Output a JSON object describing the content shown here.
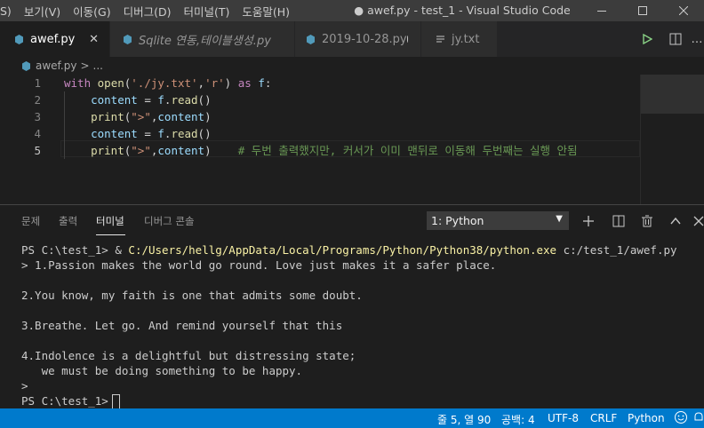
{
  "menu": [
    "S)",
    "보기(V)",
    "이동(G)",
    "디버그(D)",
    "터미널(T)",
    "도움말(H)"
  ],
  "window_title": "● awef.py - test_1 - Visual Studio Code",
  "tabs": [
    {
      "label": "awef.py",
      "active": true,
      "icon": "python-icon",
      "trailing": "close"
    },
    {
      "label": "Sqlite 연동,테이블생성.py",
      "active": false,
      "icon": "python-icon",
      "trailing": ""
    },
    {
      "label": "2019-10-28.py",
      "active": false,
      "icon": "python-icon",
      "trailing": "dirty"
    },
    {
      "label": "jy.txt",
      "active": false,
      "icon": "text-file-icon",
      "trailing": ""
    }
  ],
  "breadcrumb": {
    "file": "awef.py",
    "sep": ">",
    "rest": "..."
  },
  "editor": {
    "line_numbers": [
      "1",
      "2",
      "3",
      "4",
      "5"
    ],
    "current_line": 5,
    "lines": [
      [
        {
          "t": "with",
          "c": "kw"
        },
        {
          "t": " ",
          "c": "pl"
        },
        {
          "t": "open",
          "c": "fn"
        },
        {
          "t": "(",
          "c": "pl"
        },
        {
          "t": "'./jy.txt'",
          "c": "str"
        },
        {
          "t": ",",
          "c": "pl"
        },
        {
          "t": "'r'",
          "c": "str"
        },
        {
          "t": ") ",
          "c": "pl"
        },
        {
          "t": "as",
          "c": "kw"
        },
        {
          "t": " ",
          "c": "pl"
        },
        {
          "t": "f",
          "c": "id"
        },
        {
          "t": ":",
          "c": "pl"
        }
      ],
      [
        {
          "t": "    ",
          "c": "pl"
        },
        {
          "t": "content",
          "c": "id"
        },
        {
          "t": " = ",
          "c": "pl"
        },
        {
          "t": "f",
          "c": "id"
        },
        {
          "t": ".",
          "c": "pl"
        },
        {
          "t": "read",
          "c": "fn"
        },
        {
          "t": "()",
          "c": "pl"
        }
      ],
      [
        {
          "t": "    ",
          "c": "pl"
        },
        {
          "t": "print",
          "c": "fn"
        },
        {
          "t": "(",
          "c": "pl"
        },
        {
          "t": "\">\"",
          "c": "str"
        },
        {
          "t": ",",
          "c": "pl"
        },
        {
          "t": "content",
          "c": "id"
        },
        {
          "t": ")",
          "c": "pl"
        }
      ],
      [
        {
          "t": "    ",
          "c": "pl"
        },
        {
          "t": "content",
          "c": "id"
        },
        {
          "t": " = ",
          "c": "pl"
        },
        {
          "t": "f",
          "c": "id"
        },
        {
          "t": ".",
          "c": "pl"
        },
        {
          "t": "read",
          "c": "fn"
        },
        {
          "t": "()",
          "c": "pl"
        }
      ],
      [
        {
          "t": "    ",
          "c": "pl"
        },
        {
          "t": "print",
          "c": "fn"
        },
        {
          "t": "(",
          "c": "pl"
        },
        {
          "t": "\">\"",
          "c": "str"
        },
        {
          "t": ",",
          "c": "pl"
        },
        {
          "t": "content",
          "c": "id"
        },
        {
          "t": ")    ",
          "c": "pl"
        },
        {
          "t": "# 두번 출력했지만, 커서가 이미 맨뒤로 이동해 두번째는 실행 안됨",
          "c": "cm"
        }
      ]
    ]
  },
  "panel": {
    "tabs": [
      "문제",
      "출력",
      "터미널",
      "디버그 콘솔"
    ],
    "active_tab": 2,
    "terminal_select": "1: Python"
  },
  "terminal": {
    "command_prefix": "PS C:\\test_1> & ",
    "command_path": "C:/Users/hellg/AppData/Local/Programs/Python/Python38/python.exe",
    "command_arg": " c:/test_1/awef.py",
    "output": [
      "> 1.Passion makes the world go round. Love just makes it a safer place.",
      "",
      "2.You know, my faith is one that admits some doubt.",
      "",
      "3.Breathe. Let go. And remind yourself that this",
      "",
      "4.Indolence is a delightful but distressing state;",
      "   we must be doing something to be happy.",
      ">"
    ],
    "prompt": "PS C:\\test_1>"
  },
  "status": {
    "position": "줄 5, 열 90",
    "spaces": "공백: 4",
    "encoding": "UTF-8",
    "eol": "CRLF",
    "language": "Python"
  },
  "colors": {
    "accent": "#007acc",
    "editor_bg": "#1e1e1e",
    "titlebar": "#3c3c3c"
  }
}
